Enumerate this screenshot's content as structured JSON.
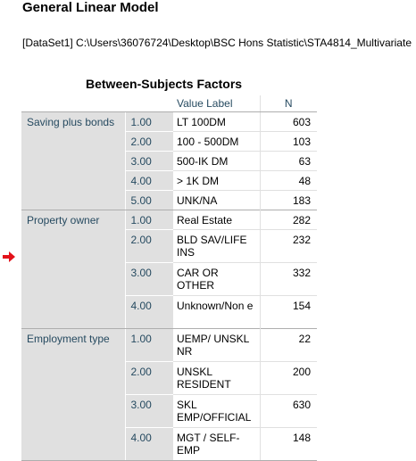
{
  "header": {
    "title": "General Linear Model",
    "dataset_path": "[DataSet1] C:\\Users\\36076724\\Desktop\\BSC Hons Statistic\\STA4814_Multivariate"
  },
  "table": {
    "title": "Between-Subjects Factors",
    "columns": {
      "value_label": "Value Label",
      "n": "N"
    },
    "groups": [
      {
        "factor": "Saving plus bonds",
        "rows": [
          {
            "value": "1.00",
            "label": "LT 100DM",
            "n": "603"
          },
          {
            "value": "2.00",
            "label": "100 - 500DM",
            "n": "103"
          },
          {
            "value": "3.00",
            "label": "500-IK DM",
            "n": "63"
          },
          {
            "value": "4.00",
            "label": "> 1K DM",
            "n": "48"
          },
          {
            "value": "5.00",
            "label": "UNK/NA",
            "n": "183"
          }
        ]
      },
      {
        "factor": "Property owner",
        "rows": [
          {
            "value": "1.00",
            "label": "Real Estate",
            "n": "282"
          },
          {
            "value": "2.00",
            "label": "BLD SAV/LIFE INS",
            "n": "232"
          },
          {
            "value": "3.00",
            "label": "CAR OR OTHER",
            "n": "332"
          },
          {
            "value": "4.00",
            "label": "Unknown/Non e",
            "n": "154"
          }
        ]
      },
      {
        "factor": "Employment type",
        "rows": [
          {
            "value": "1.00",
            "label": "UEMP/ UNSKL NR",
            "n": "22"
          },
          {
            "value": "2.00",
            "label": "UNSKL RESIDENT",
            "n": "200"
          },
          {
            "value": "3.00",
            "label": "SKL EMP/OFFICIAL",
            "n": "630"
          },
          {
            "value": "4.00",
            "label": "MGT / SELF-EMP",
            "n": "148"
          }
        ]
      }
    ]
  },
  "icons": {
    "marker": "red-arrow-right-icon"
  },
  "colors": {
    "marker": "#e3121a",
    "header_text": "#264a60",
    "row_header_bg": "#e0e0e0"
  }
}
